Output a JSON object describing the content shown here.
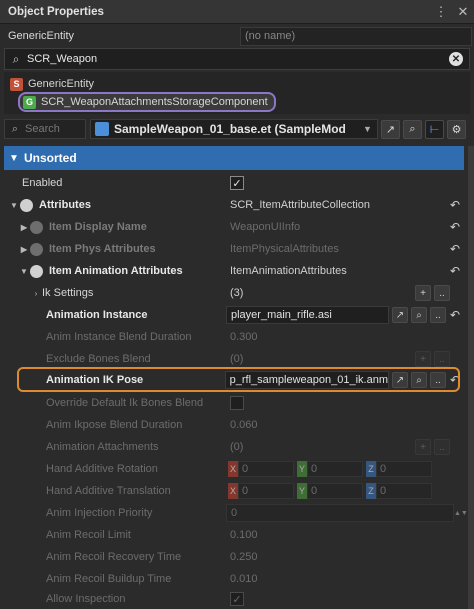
{
  "window": {
    "title": "Object Properties",
    "menu_icon": "⋮",
    "close_icon": "✕"
  },
  "entity": {
    "type_label": "GenericEntity",
    "name_placeholder": "(no name)"
  },
  "component_search": {
    "value": "SCR_Weapon"
  },
  "component_tree": {
    "items": [
      {
        "badge": "S",
        "label": "GenericEntity"
      },
      {
        "badge": "G",
        "label": "SCR_WeaponAttachmentsStorageComponent"
      }
    ]
  },
  "toolbar": {
    "search_placeholder": "Search",
    "prefab_name": "SampleWeapon_01_base.et (SampleMod"
  },
  "group": {
    "label": "Unsorted"
  },
  "properties": {
    "enabled": {
      "label": "Enabled",
      "checked": "✓"
    },
    "attributes": {
      "label": "Attributes",
      "value": "SCR_ItemAttributeCollection"
    },
    "item_display_name": {
      "label": "Item Display Name",
      "value": "WeaponUIInfo"
    },
    "item_phys_attributes": {
      "label": "Item Phys Attributes",
      "value": "ItemPhysicalAttributes"
    },
    "item_animation_attributes": {
      "label": "Item Animation Attributes",
      "value": "ItemAnimationAttributes"
    },
    "ik_settings": {
      "label": "Ik Settings",
      "value": "(3)"
    },
    "animation_instance": {
      "label": "Animation Instance",
      "value": "player_main_rifle.asi"
    },
    "anim_instance_blend_duration": {
      "label": "Anim Instance Blend Duration",
      "value": "0.300"
    },
    "exclude_bones_blend": {
      "label": "Exclude Bones Blend",
      "value": "(0)"
    },
    "animation_ik_pose": {
      "label": "Animation IK Pose",
      "value": "p_rfl_sampleweapon_01_ik.anm"
    },
    "override_default_ik_bones_blend": {
      "label": "Override Default Ik Bones Blend"
    },
    "anim_ikpose_blend_duration": {
      "label": "Anim Ikpose Blend Duration",
      "value": "0.060"
    },
    "animation_attachments": {
      "label": "Animation Attachments",
      "value": "(0)"
    },
    "hand_additive_rotation": {
      "label": "Hand Additive Rotation",
      "x": "0",
      "y": "0",
      "z": "0"
    },
    "hand_additive_translation": {
      "label": "Hand Additive Translation",
      "x": "0",
      "y": "0",
      "z": "0"
    },
    "anim_injection_priority": {
      "label": "Anim Injection Priority",
      "value": "0"
    },
    "anim_recoil_limit": {
      "label": "Anim Recoil Limit",
      "value": "0.100"
    },
    "anim_recoil_recovery_time": {
      "label": "Anim Recoil Recovery Time",
      "value": "0.250"
    },
    "anim_recoil_buildup_time": {
      "label": "Anim Recoil Buildup Time",
      "value": "0.010"
    },
    "allow_inspection": {
      "label": "Allow Inspection",
      "checked": "✓"
    }
  },
  "vector_tags": {
    "x": "X",
    "y": "Y",
    "z": "Z"
  },
  "glyphs": {
    "plus": "+",
    "dots": "..",
    "reset": "↶",
    "spin": "▲▼"
  },
  "colors": {
    "group_header": "#2f6db0",
    "selected_component_outline": "#8c76c8",
    "highlight_outline": "#e08a2e"
  }
}
